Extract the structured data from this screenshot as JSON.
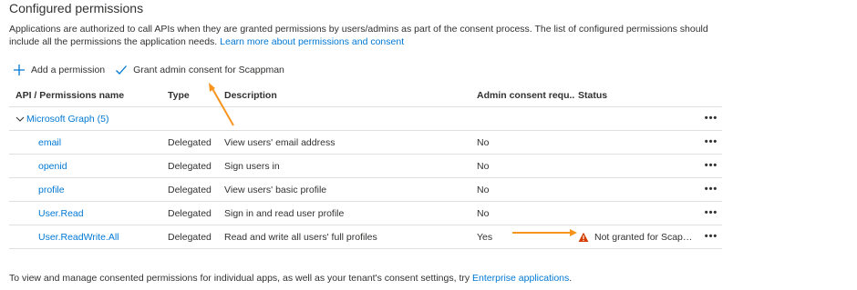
{
  "page": {
    "title": "Configured permissions",
    "description": "Applications are authorized to call APIs when they are granted permissions by users/admins as part of the consent process. The list of configured permissions should include all the permissions the application needs.",
    "learn_more": "Learn more about permissions and consent"
  },
  "toolbar": {
    "add_label": "Add a permission",
    "grant_label": "Grant admin consent for Scappman"
  },
  "table": {
    "headers": {
      "name": "API / Permissions name",
      "type": "Type",
      "description": "Description",
      "admin": "Admin consent requ...",
      "status": "Status"
    },
    "group": "Microsoft Graph (5)",
    "rows": [
      {
        "name": "email",
        "type": "Delegated",
        "description": "View users' email address",
        "admin": "No",
        "status": ""
      },
      {
        "name": "openid",
        "type": "Delegated",
        "description": "Sign users in",
        "admin": "No",
        "status": ""
      },
      {
        "name": "profile",
        "type": "Delegated",
        "description": "View users' basic profile",
        "admin": "No",
        "status": ""
      },
      {
        "name": "User.Read",
        "type": "Delegated",
        "description": "Sign in and read user profile",
        "admin": "No",
        "status": ""
      },
      {
        "name": "User.ReadWrite.All",
        "type": "Delegated",
        "description": "Read and write all users' full profiles",
        "admin": "Yes",
        "status": "Not granted for Scappm..."
      }
    ],
    "more": "•••"
  },
  "footer": {
    "text": "To view and manage consented permissions for individual apps, as well as your tenant's consent settings, try",
    "link": "Enterprise applications",
    "end": "."
  },
  "colors": {
    "link": "#0078d4",
    "warning": "#d83b01",
    "annotation_arrow": "#f7941d",
    "divider": "#e1dfdd"
  },
  "icons": {
    "add": "plus-icon",
    "grant": "checkmark-icon",
    "group": "chevron-down-icon",
    "warning": "warning-icon",
    "more": "more-icon"
  }
}
